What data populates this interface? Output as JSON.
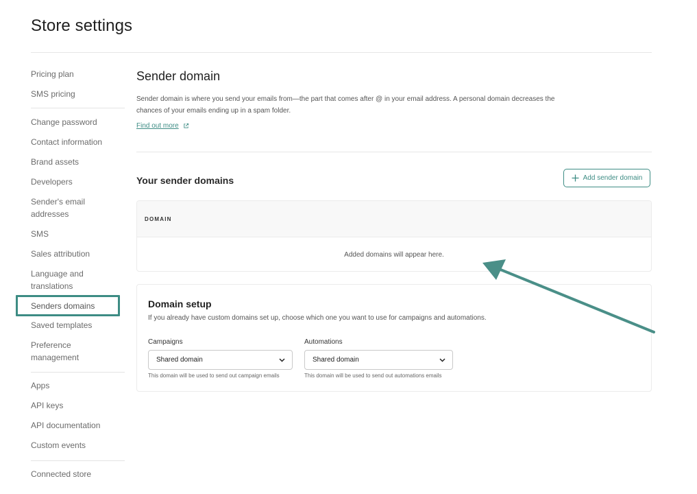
{
  "page": {
    "title": "Store settings"
  },
  "sidebar": {
    "items": [
      {
        "label": "Pricing plan"
      },
      {
        "label": "SMS pricing"
      },
      {
        "label": "Change password"
      },
      {
        "label": "Contact information"
      },
      {
        "label": "Brand assets"
      },
      {
        "label": "Developers"
      },
      {
        "label": "Sender's email addresses"
      },
      {
        "label": "SMS"
      },
      {
        "label": "Sales attribution"
      },
      {
        "label": "Language and translations"
      },
      {
        "label": "Senders domains"
      },
      {
        "label": "Saved templates"
      },
      {
        "label": "Preference management"
      },
      {
        "label": "Apps"
      },
      {
        "label": "API keys"
      },
      {
        "label": "API documentation"
      },
      {
        "label": "Custom events"
      },
      {
        "label": "Connected store"
      }
    ],
    "active_label": "Senders domains"
  },
  "sender_domain": {
    "title": "Sender domain",
    "description": "Sender domain is where you send your emails from—the part that comes after @ in your email address. A personal domain decreases the chances of your emails ending up in a spam folder.",
    "find_more": "Find out more",
    "link_icon": "external-link-icon"
  },
  "your_domains": {
    "title": "Your sender domains",
    "add_button": "Add sender domain",
    "add_icon": "plus-icon",
    "table": {
      "column_header": "DOMAIN",
      "empty_text": "Added domains will appear here."
    }
  },
  "domain_setup": {
    "title": "Domain setup",
    "description": "If you already have custom domains set up, choose which one you want to use for campaigns and automations.",
    "campaigns": {
      "label": "Campaigns",
      "value": "Shared domain",
      "help": "This domain will be used to send out campaign emails"
    },
    "automations": {
      "label": "Automations",
      "value": "Shared domain",
      "help": "This domain will be used to send out automations emails"
    }
  },
  "colors": {
    "accent": "#3d8c84",
    "highlight_border": "#3d8c84",
    "annotation_arrow": "#4a8f88"
  }
}
